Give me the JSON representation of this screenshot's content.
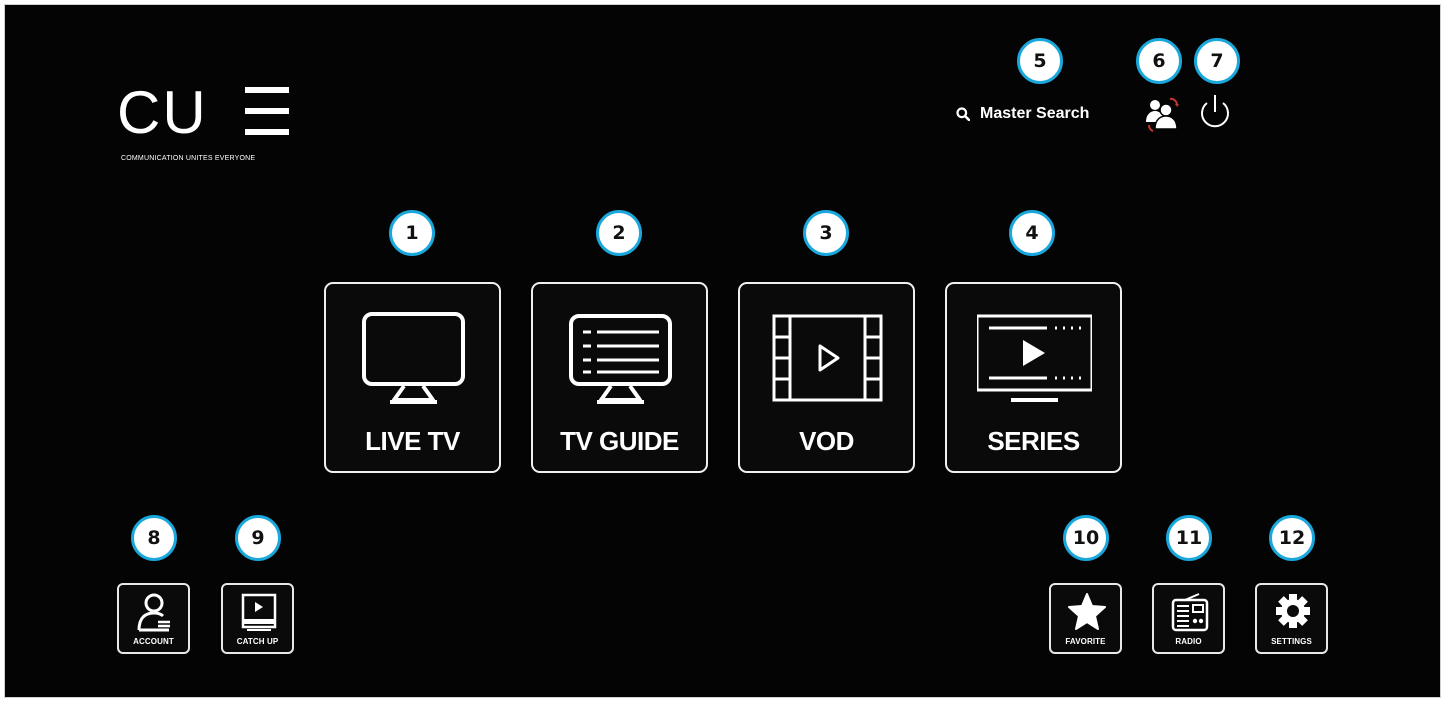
{
  "logo": {
    "brand": "CU",
    "tagline": "COMMUNICATION UNITES EVERYONE"
  },
  "header": {
    "search_label": "Master Search",
    "search_icon": "search-icon",
    "profile_icon": "switch-profile-icon",
    "power_icon": "power-icon"
  },
  "tiles": [
    {
      "label": "LIVE TV",
      "icon": "tv-icon",
      "badge": "1"
    },
    {
      "label": "TV GUIDE",
      "icon": "tv-guide-icon",
      "badge": "2"
    },
    {
      "label": "VOD",
      "icon": "film-play-icon",
      "badge": "3"
    },
    {
      "label": "SERIES",
      "icon": "series-play-icon",
      "badge": "4"
    }
  ],
  "header_badges": [
    "5",
    "6",
    "7"
  ],
  "small_tiles": [
    {
      "label": "ACCOUNT",
      "icon": "account-icon",
      "badge": "8"
    },
    {
      "label": "CATCH UP",
      "icon": "catch-up-icon",
      "badge": "9"
    },
    {
      "label": "FAVORITE",
      "icon": "star-icon",
      "badge": "10"
    },
    {
      "label": "RADIO",
      "icon": "radio-icon",
      "badge": "11"
    },
    {
      "label": "SETTINGS",
      "icon": "gear-icon",
      "badge": "12"
    }
  ],
  "colors": {
    "background": "#040404",
    "badge_border": "#1aa7dc",
    "foreground": "#ffffff",
    "accent_red": "#c0392b"
  }
}
